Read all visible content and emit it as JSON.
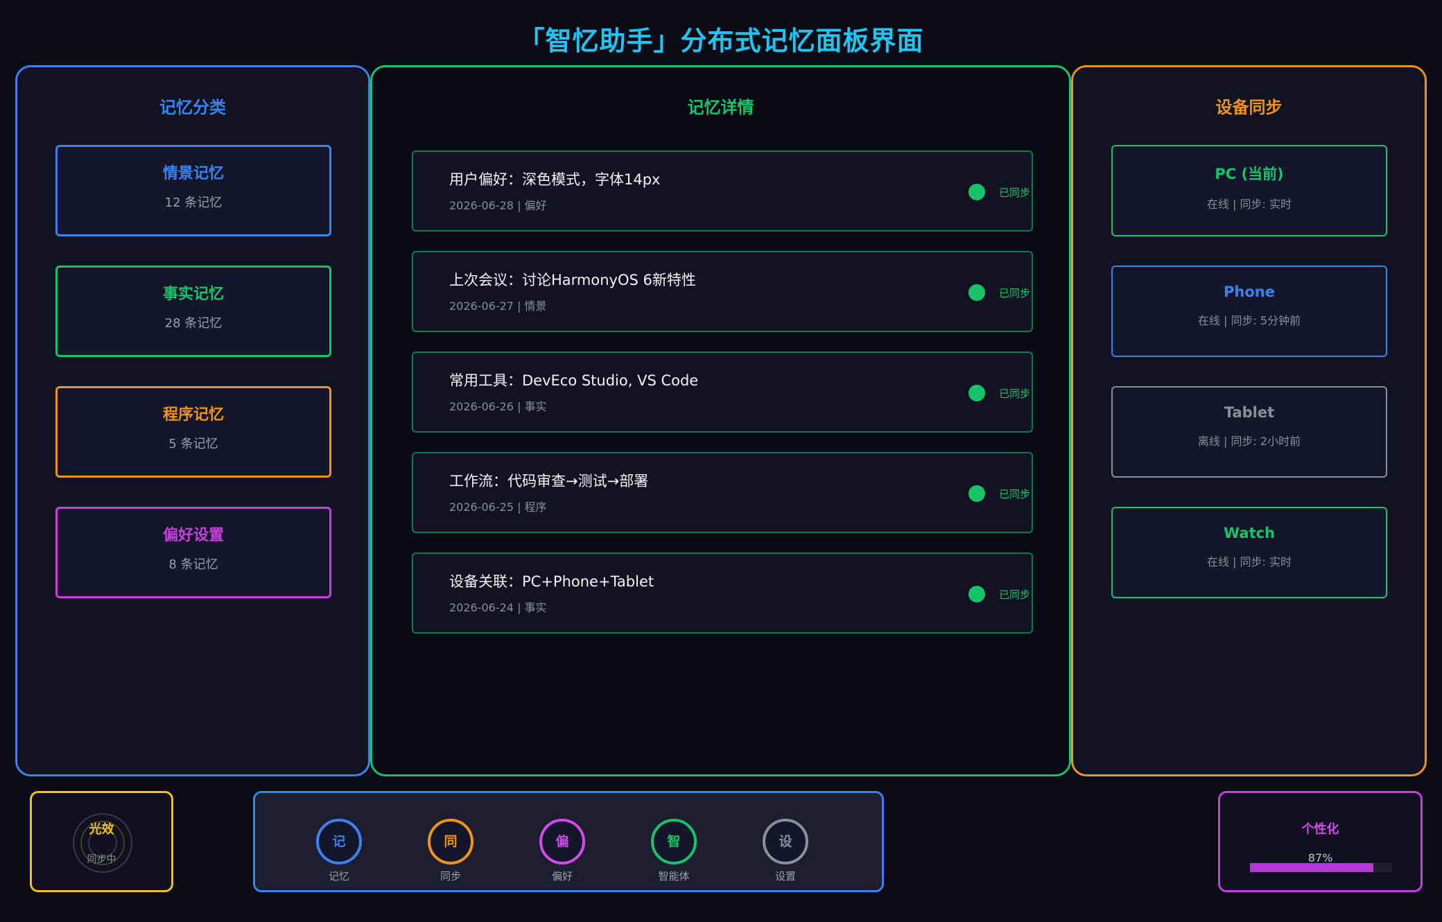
{
  "title": "「智忆助手」分布式记忆面板界面",
  "categories": {
    "heading": "记忆分类",
    "items": [
      {
        "name": "情景记忆",
        "count": "12 条记忆",
        "color": "#3b82f0"
      },
      {
        "name": "事实记忆",
        "count": "28 条记忆",
        "color": "#16c46a"
      },
      {
        "name": "程序记忆",
        "count": "5 条记忆",
        "color": "#f0921c"
      },
      {
        "name": "偏好设置",
        "count": "8 条记忆",
        "color": "#c83ee0"
      }
    ]
  },
  "details": {
    "heading": "记忆详情",
    "items": [
      {
        "text": "用户偏好：深色模式，字体14px",
        "meta": "2026-06-28 | 偏好",
        "status": "已同步"
      },
      {
        "text": "上次会议：讨论HarmonyOS 6新特性",
        "meta": "2026-06-27 | 情景",
        "status": "已同步"
      },
      {
        "text": "常用工具：DevEco Studio, VS Code",
        "meta": "2026-06-26 | 事实",
        "status": "已同步"
      },
      {
        "text": "工作流：代码审查→测试→部署",
        "meta": "2026-06-25 | 程序",
        "status": "已同步"
      },
      {
        "text": "设备关联：PC+Phone+Tablet",
        "meta": "2026-06-24 | 事实",
        "status": "已同步"
      }
    ]
  },
  "devices": {
    "heading": "设备同步",
    "items": [
      {
        "name": "PC (当前)",
        "status": "在线 | 同步: 实时",
        "color": "#16c46a"
      },
      {
        "name": "Phone",
        "status": "在线 | 同步: 5分钟前",
        "color": "#3b82f0"
      },
      {
        "name": "Tablet",
        "status": "离线 | 同步: 2小时前",
        "color": "#8a8f9c"
      },
      {
        "name": "Watch",
        "status": "在线 | 同步: 实时",
        "color": "#16c46a"
      }
    ]
  },
  "glow": {
    "title": "光效",
    "status": "同步中"
  },
  "nav": [
    {
      "glyph": "记",
      "label": "记忆",
      "color": "#3b82f0"
    },
    {
      "glyph": "同",
      "label": "同步",
      "color": "#f0921c"
    },
    {
      "glyph": "偏",
      "label": "偏好",
      "color": "#d24ae8"
    },
    {
      "glyph": "智",
      "label": "智能体",
      "color": "#16c46a"
    },
    {
      "glyph": "设",
      "label": "设置",
      "color": "#8a8f9c"
    }
  ],
  "personalization": {
    "title": "个性化",
    "value": "87%",
    "progress": 0.87
  }
}
